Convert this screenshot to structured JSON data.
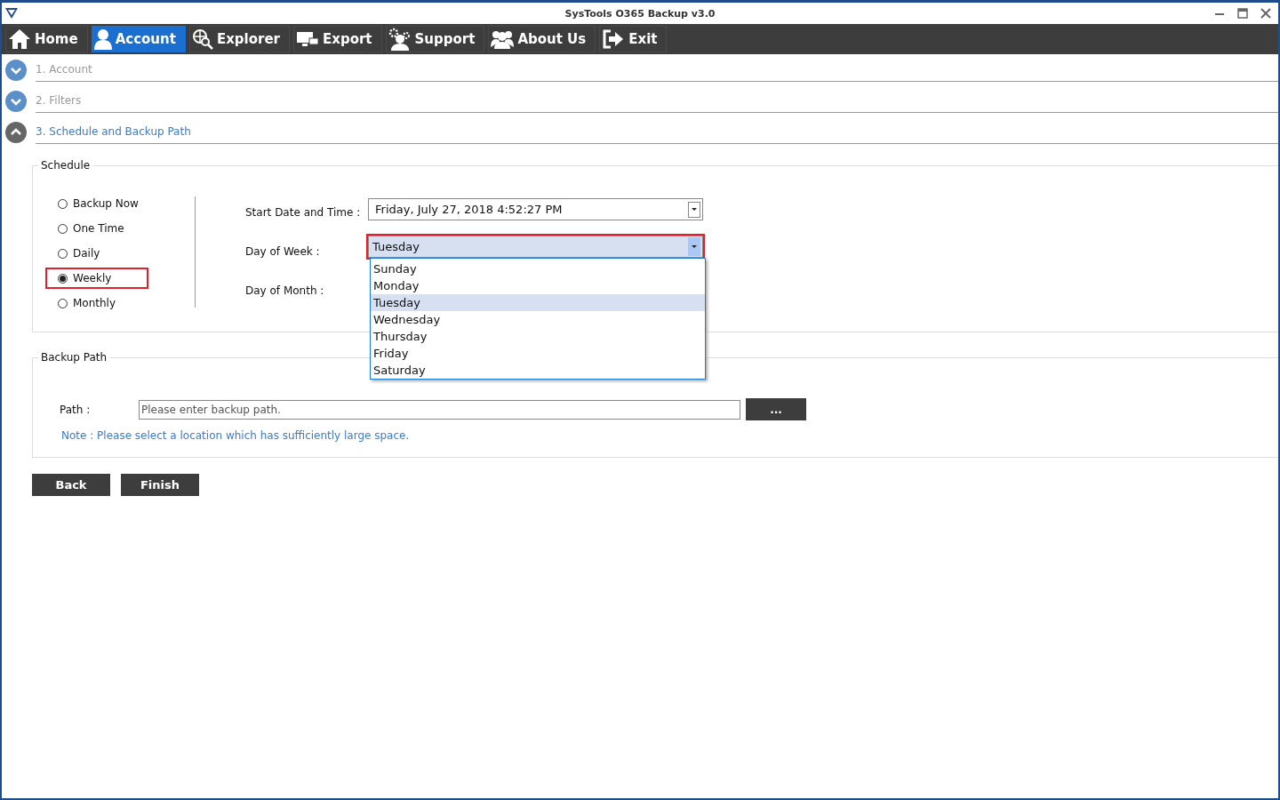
{
  "window": {
    "title": "SysTools O365 Backup v3.0"
  },
  "toolbar": [
    {
      "label": "Home",
      "kind": "home",
      "selected": false
    },
    {
      "label": "Account",
      "kind": "user",
      "selected": true
    },
    {
      "label": "Explorer",
      "kind": "explorer",
      "selected": false
    },
    {
      "label": "Export",
      "kind": "export",
      "selected": false
    },
    {
      "label": "Support",
      "kind": "support",
      "selected": false
    },
    {
      "label": "About Us",
      "kind": "users",
      "selected": false
    },
    {
      "label": "Exit",
      "kind": "exit",
      "selected": false
    }
  ],
  "steps": [
    {
      "label": "1. Account",
      "expanded": false
    },
    {
      "label": "2. Filters",
      "expanded": false
    },
    {
      "label": "3. Schedule and Backup Path",
      "expanded": true
    }
  ],
  "schedule": {
    "title": "Schedule",
    "options": [
      {
        "label": "Backup Now",
        "selected": false,
        "highlighted": false
      },
      {
        "label": "One Time",
        "selected": false,
        "highlighted": false
      },
      {
        "label": "Daily",
        "selected": false,
        "highlighted": false
      },
      {
        "label": "Weekly",
        "selected": true,
        "highlighted": true
      },
      {
        "label": "Monthly",
        "selected": false,
        "highlighted": false
      }
    ],
    "start_label": "Start Date and Time :",
    "start_value": "Friday, July  27, 2018  4:52:27  PM",
    "dow_label": "Day  of Week :",
    "dow_value": "Tuesday",
    "dow_highlighted": true,
    "dom_label": "Day  of  Month :",
    "dow_options": [
      {
        "label": "Sunday",
        "selected": false
      },
      {
        "label": "Monday",
        "selected": false
      },
      {
        "label": "Tuesday",
        "selected": true
      },
      {
        "label": "Wednesday",
        "selected": false
      },
      {
        "label": "Thursday",
        "selected": false
      },
      {
        "label": "Friday",
        "selected": false
      },
      {
        "label": "Saturday",
        "selected": false
      }
    ]
  },
  "backup_path": {
    "title": "Backup Path",
    "label": "Path :",
    "placeholder": "Please enter backup path.",
    "browse": "...",
    "note": "Note : Please select a location which has sufficiently large space."
  },
  "buttons": [
    "Back",
    "Finish"
  ]
}
